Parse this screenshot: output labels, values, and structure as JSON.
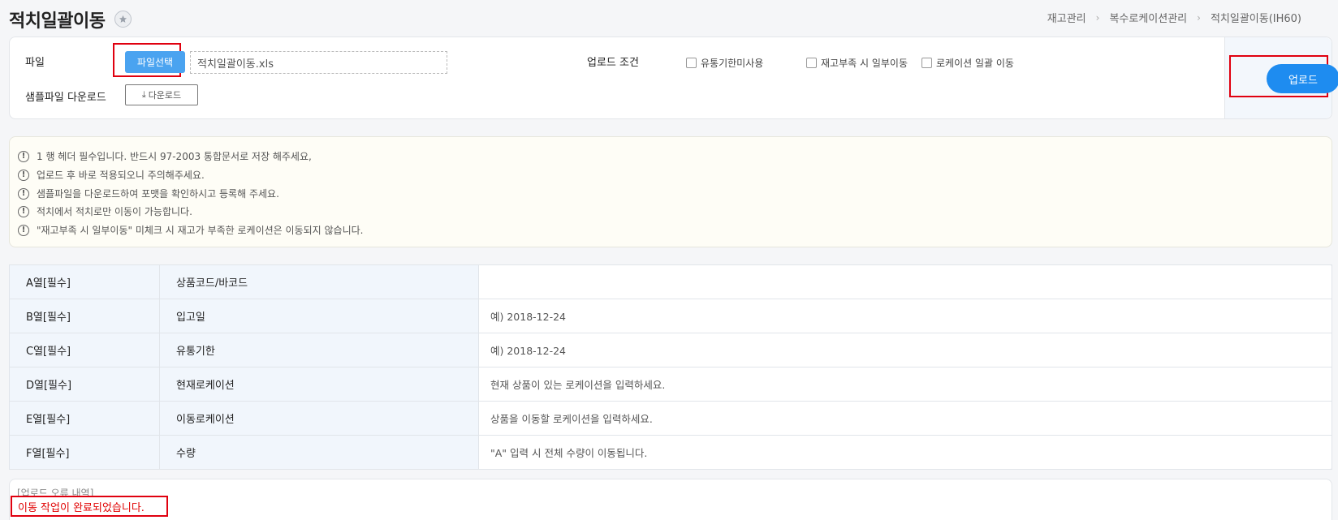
{
  "header": {
    "title": "적치일괄이동",
    "breadcrumb": [
      "재고관리",
      "복수로케이션관리",
      "적치일괄이동(IH60)"
    ]
  },
  "file_panel": {
    "file_label": "파일",
    "file_button": "파일선택",
    "file_name": "적치일괄이동.xls",
    "sample_label": "샘플파일 다운로드",
    "download_button": "다운로드",
    "condition_label": "업로드 조건",
    "options": [
      {
        "label": "유통기한미사용",
        "checked": false
      },
      {
        "label": "재고부족 시 일부이동",
        "checked": false
      },
      {
        "label": "로케이션 일괄 이동",
        "checked": false
      }
    ],
    "upload_button": "업로드"
  },
  "notices": [
    "1 행 헤더 필수입니다. 반드시 97-2003 통합문서로 저장 해주세요,",
    "업로드 후 바로 적용되오니 주의해주세요.",
    "샘플파일을 다운로드하여 포맷을 확인하시고 등록해 주세요.",
    "적치에서 적치로만 이동이 가능합니다.",
    "\"재고부족 시 일부이동\" 미체크 시 재고가 부족한 로케이션은 이동되지 않습니다."
  ],
  "columns": [
    {
      "col": "A열[필수]",
      "field": "상품코드/바코드",
      "desc": ""
    },
    {
      "col": "B열[필수]",
      "field": "입고일",
      "desc": "예) 2018-12-24"
    },
    {
      "col": "C열[필수]",
      "field": "유통기한",
      "desc": "예) 2018-12-24"
    },
    {
      "col": "D열[필수]",
      "field": "현재로케이션",
      "desc": "현재 상품이 있는 로케이션을 입력하세요."
    },
    {
      "col": "E열[필수]",
      "field": "이동로케이션",
      "desc": "상품을 이동할 로케이션을 입력하세요."
    },
    {
      "col": "F열[필수]",
      "field": "수량",
      "desc": "\"A\" 입력 시 전체 수량이 이동됩니다."
    }
  ],
  "error_log": {
    "title": "[업로드 오류 내역]",
    "message": "이동 작업이 완료되었습니다."
  }
}
